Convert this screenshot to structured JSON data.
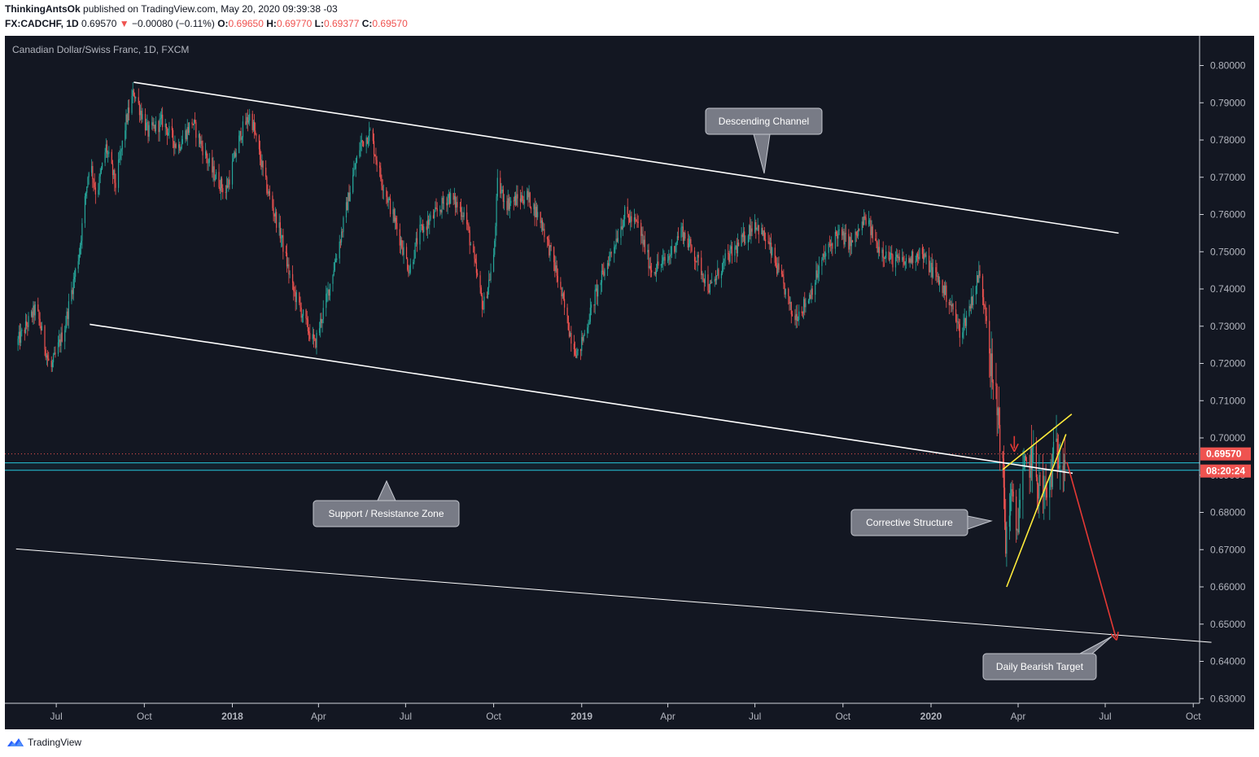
{
  "header": {
    "author": "ThinkingAntsOk",
    "published_text": "published on TradingView.com, May 20, 2020 09:39:38 -03",
    "symbol": "FX:CADCHF, 1D",
    "last": "0.69570",
    "change": "−0.00080 (−0.11%)",
    "o_label": "O:",
    "o": "0.69650",
    "h_label": "H:",
    "h": "0.69770",
    "l_label": "L:",
    "l": "0.69377",
    "c_label": "C:",
    "c": "0.69570"
  },
  "footer": {
    "brand": "TradingView"
  },
  "chart_data": {
    "type": "candlestick",
    "title": "Canadian Dollar/Swiss Franc, 1D, FXCM",
    "ylim": [
      0.6255,
      0.8085
    ],
    "y_ticks": [
      "0.80000",
      "0.79000",
      "0.78000",
      "0.77000",
      "0.76000",
      "0.75000",
      "0.74000",
      "0.73000",
      "0.72000",
      "0.71000",
      "0.70000",
      "0.69000",
      "0.68000",
      "0.67000",
      "0.66000",
      "0.65000",
      "0.64000",
      "0.63000"
    ],
    "x_ticks": [
      "Jul",
      "Oct",
      "2018",
      "Apr",
      "Jul",
      "Oct",
      "2019",
      "Apr",
      "Jul",
      "Oct",
      "2020",
      "Apr",
      "Jul",
      "Oct"
    ],
    "price_label": "0.69570",
    "countdown_label": "08:20:24",
    "price_path": [
      [
        "2017-05-20",
        0.725
      ],
      [
        "2017-06-10",
        0.735
      ],
      [
        "2017-06-25",
        0.718
      ],
      [
        "2017-07-10",
        0.73
      ],
      [
        "2017-07-25",
        0.75
      ],
      [
        "2017-08-05",
        0.775
      ],
      [
        "2017-08-12",
        0.765
      ],
      [
        "2017-08-22",
        0.778
      ],
      [
        "2017-09-01",
        0.768
      ],
      [
        "2017-09-12",
        0.785
      ],
      [
        "2017-09-20",
        0.793
      ],
      [
        "2017-10-05",
        0.782
      ],
      [
        "2017-10-20",
        0.785
      ],
      [
        "2017-11-05",
        0.778
      ],
      [
        "2017-11-20",
        0.785
      ],
      [
        "2017-12-10",
        0.772
      ],
      [
        "2017-12-25",
        0.766
      ],
      [
        "2018-01-10",
        0.782
      ],
      [
        "2018-01-20",
        0.787
      ],
      [
        "2018-02-05",
        0.768
      ],
      [
        "2018-02-20",
        0.755
      ],
      [
        "2018-03-05",
        0.74
      ],
      [
        "2018-03-20",
        0.73
      ],
      [
        "2018-03-28",
        0.725
      ],
      [
        "2018-04-10",
        0.738
      ],
      [
        "2018-04-25",
        0.755
      ],
      [
        "2018-05-05",
        0.768
      ],
      [
        "2018-05-15",
        0.779
      ],
      [
        "2018-05-25",
        0.782
      ],
      [
        "2018-06-05",
        0.77
      ],
      [
        "2018-06-20",
        0.758
      ],
      [
        "2018-07-05",
        0.745
      ],
      [
        "2018-07-15",
        0.755
      ],
      [
        "2018-08-01",
        0.76
      ],
      [
        "2018-08-15",
        0.765
      ],
      [
        "2018-09-01",
        0.76
      ],
      [
        "2018-09-10",
        0.748
      ],
      [
        "2018-09-20",
        0.735
      ],
      [
        "2018-10-01",
        0.748
      ],
      [
        "2018-10-05",
        0.768
      ],
      [
        "2018-10-15",
        0.763
      ],
      [
        "2018-11-05",
        0.765
      ],
      [
        "2018-11-20",
        0.758
      ],
      [
        "2018-12-05",
        0.745
      ],
      [
        "2018-12-20",
        0.728
      ],
      [
        "2018-12-28",
        0.722
      ],
      [
        "2019-01-15",
        0.738
      ],
      [
        "2019-02-01",
        0.75
      ],
      [
        "2019-02-15",
        0.76
      ],
      [
        "2019-03-01",
        0.757
      ],
      [
        "2019-03-15",
        0.745
      ],
      [
        "2019-04-01",
        0.748
      ],
      [
        "2019-04-15",
        0.756
      ],
      [
        "2019-05-01",
        0.748
      ],
      [
        "2019-05-15",
        0.74
      ],
      [
        "2019-06-01",
        0.748
      ],
      [
        "2019-06-15",
        0.752
      ],
      [
        "2019-07-01",
        0.758
      ],
      [
        "2019-07-15",
        0.752
      ],
      [
        "2019-08-01",
        0.74
      ],
      [
        "2019-08-10",
        0.732
      ],
      [
        "2019-08-25",
        0.737
      ],
      [
        "2019-09-10",
        0.748
      ],
      [
        "2019-09-25",
        0.755
      ],
      [
        "2019-10-10",
        0.752
      ],
      [
        "2019-10-25",
        0.759
      ],
      [
        "2019-11-05",
        0.752
      ],
      [
        "2019-11-20",
        0.748
      ],
      [
        "2019-12-05",
        0.747
      ],
      [
        "2019-12-20",
        0.75
      ],
      [
        "2020-01-05",
        0.744
      ],
      [
        "2020-01-20",
        0.737
      ],
      [
        "2020-02-01",
        0.728
      ],
      [
        "2020-02-10",
        0.735
      ],
      [
        "2020-02-20",
        0.744
      ],
      [
        "2020-02-28",
        0.733
      ],
      [
        "2020-03-05",
        0.715
      ],
      [
        "2020-03-12",
        0.705
      ],
      [
        "2020-03-16",
        0.69
      ],
      [
        "2020-03-19",
        0.672
      ],
      [
        "2020-03-24",
        0.685
      ],
      [
        "2020-03-30",
        0.675
      ],
      [
        "2020-04-05",
        0.688
      ],
      [
        "2020-04-15",
        0.695
      ],
      [
        "2020-04-22",
        0.688
      ],
      [
        "2020-05-01",
        0.684
      ],
      [
        "2020-05-10",
        0.697
      ],
      [
        "2020-05-20",
        0.6957
      ]
    ],
    "trendlines": [
      {
        "name": "channel-top",
        "color": "#ffffff",
        "points": [
          [
            "2017-09-20",
            0.7955
          ],
          [
            "2020-07-15",
            0.755
          ]
        ]
      },
      {
        "name": "channel-mid",
        "color": "#ffffff",
        "points": [
          [
            "2017-08-05",
            0.7305
          ],
          [
            "2020-05-28",
            0.6905
          ]
        ]
      },
      {
        "name": "channel-bottom",
        "color": "#ffffff",
        "points": [
          [
            "2017-05-20",
            0.6702
          ],
          [
            "2020-10-20",
            0.6451
          ]
        ]
      },
      {
        "name": "wedge-upper",
        "color": "#ffeb3b",
        "points": [
          [
            "2020-03-16",
            0.6915
          ],
          [
            "2020-05-27",
            0.7064
          ]
        ]
      },
      {
        "name": "wedge-lower",
        "color": "#ffeb3b",
        "points": [
          [
            "2020-03-20",
            0.66
          ],
          [
            "2020-05-21",
            0.701
          ]
        ]
      }
    ],
    "zones": [
      {
        "name": "support-resistance-zone",
        "color": "#26c6da",
        "y1": 0.6933,
        "y2": 0.6913
      }
    ],
    "hlines": [
      {
        "name": "last-price-line",
        "color": "#ef5350",
        "style": "dotted",
        "y": 0.6957
      }
    ],
    "arrows": [
      {
        "name": "target-arrow",
        "color": "#e53935",
        "from": [
          "2020-05-22",
          0.6935
        ],
        "to": [
          "2020-07-12",
          0.6465
        ]
      },
      {
        "name": "rejection-arrow",
        "color": "#e53935",
        "from": [
          "2020-03-28",
          0.7005
        ],
        "to": [
          "2020-03-28",
          0.6972
        ]
      }
    ],
    "annotations": [
      {
        "text": "Descending Channel",
        "pointer": "down"
      },
      {
        "text": "Support / Resistance Zone",
        "pointer": "up"
      },
      {
        "text": "Corrective Structure",
        "pointer": "right"
      },
      {
        "text": "Daily Bearish Target",
        "pointer": "up-right"
      }
    ],
    "colors": {
      "background": "#131722",
      "up": "#26a69a",
      "down": "#ef5350",
      "text": "#b2b5be"
    }
  }
}
